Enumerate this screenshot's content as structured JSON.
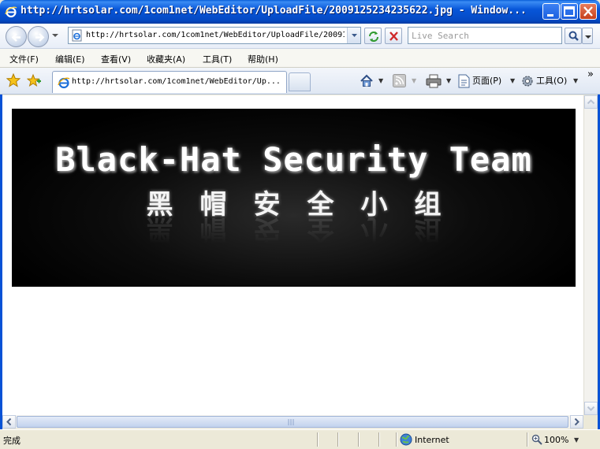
{
  "window": {
    "title": "http://hrtsolar.com/1com1net/WebEditor/UploadFile/2009125234235622.jpg - Window..."
  },
  "address_bar": {
    "url": "http://hrtsolar.com/1com1net/WebEditor/UploadFile/20091"
  },
  "search": {
    "placeholder": "Live Search"
  },
  "menu": {
    "items": [
      {
        "label": "文件(F)"
      },
      {
        "label": "编辑(E)"
      },
      {
        "label": "查看(V)"
      },
      {
        "label": "收藏夹(A)"
      },
      {
        "label": "工具(T)"
      },
      {
        "label": "帮助(H)"
      }
    ]
  },
  "tabs": {
    "active_title": "http://hrtsolar.com/1com1net/WebEditor/Up..."
  },
  "commands": {
    "page_label": "页面(P)",
    "tools_label": "工具(O)",
    "more": "»"
  },
  "content": {
    "banner_title": "Black-Hat Security Team",
    "banner_subtitle": "黑帽安全小组"
  },
  "status": {
    "text": "完成",
    "zone": "Internet",
    "zoom": "100%"
  },
  "colors": {
    "title_bar": "#0756d9",
    "banner_bg": "#000000",
    "banner_text": "#ffffff"
  }
}
